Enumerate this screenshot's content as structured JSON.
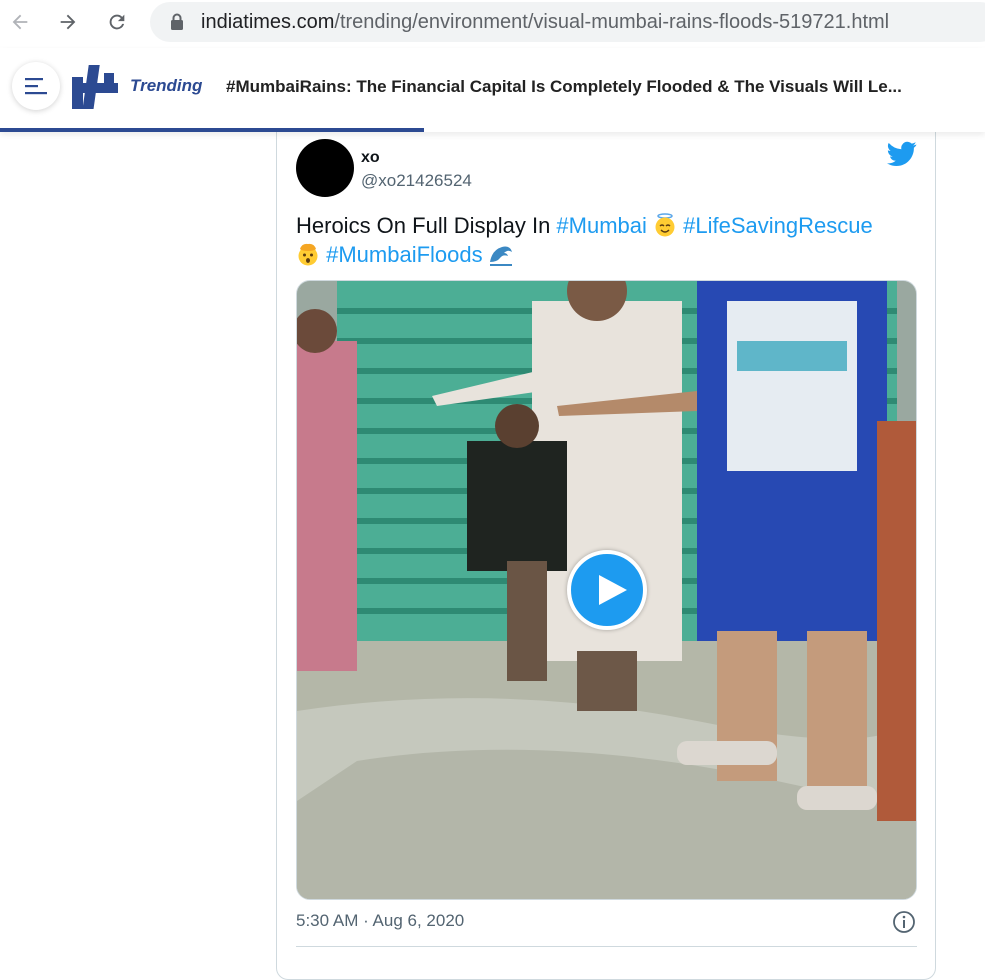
{
  "browser": {
    "url_host": "indiatimes.com",
    "url_path": "/trending/environment/visual-mumbai-rains-floods-519721.html"
  },
  "site": {
    "section": "Trending",
    "headline": "#MumbaiRains: The Financial Capital Is Completely Flooded & The Visuals Will Le...",
    "read_progress": 0.43
  },
  "tweet": {
    "display_name": "xo",
    "handle": "@xo21426524",
    "text_parts": {
      "p1": "Heroics On Full Display In ",
      "tag1": "#Mumbai",
      "tag2": "#LifeSavingRescue",
      "tag3": "#MumbaiFloods"
    },
    "timestamp": "5:30 AM · Aug 6, 2020"
  },
  "colors": {
    "brand": "#2c4a92",
    "twitter_blue": "#1d9bf0"
  },
  "icons": [
    "back-arrow-icon",
    "forward-arrow-icon",
    "reload-icon",
    "lock-icon",
    "hamburger-menu-icon",
    "indiatimes-logo",
    "twitter-bird-icon",
    "play-icon",
    "info-icon"
  ]
}
